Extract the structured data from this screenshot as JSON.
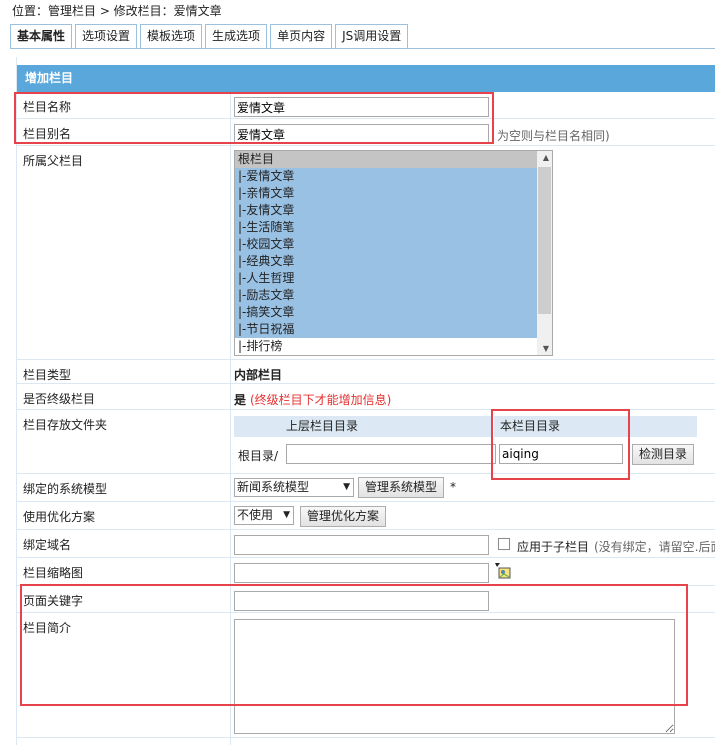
{
  "breadcrumb": "位置：管理栏目 > 修改栏目：爱情文章",
  "tabs": [
    "基本属性",
    "选项设置",
    "模板选项",
    "生成选项",
    "单页内容",
    "JS调用设置"
  ],
  "header": "增加栏目",
  "fields": {
    "name_label": "栏目名称",
    "name_value": "爱情文章",
    "alias_label": "栏目别名",
    "alias_value": "爱情文章",
    "alias_hint": "为空则与栏目名相同)",
    "parent_label": "所属父栏目",
    "parent_options": [
      "根栏目",
      "|-爱情文章",
      "|-亲情文章",
      "|-友情文章",
      "|-生活随笔",
      "|-校园文章",
      "|-经典文章",
      "|-人生哲理",
      "|-励志文章",
      "|-搞笑文章",
      "|-节日祝福",
      "|-排行榜"
    ],
    "type_label": "栏目类型",
    "type_value": "内部栏目",
    "final_label": "是否终级栏目",
    "final_value": "是",
    "final_note": "(终级栏目下才能增加信息)",
    "folder_label": "栏目存放文件夹",
    "folder_parent_head": "上层栏目目录",
    "folder_self_head": "本栏目目录",
    "folder_root": "根目录/",
    "folder_value": "aiqing",
    "check_dir_btn": "检测目录",
    "model_label": "绑定的系统模型",
    "model_value": "新闻系统模型",
    "manage_model_btn": "管理系统模型",
    "required_mark": "*",
    "opt_label": "使用优化方案",
    "opt_value": "不使用",
    "manage_opt_btn": "管理优化方案",
    "domain_label": "绑定域名",
    "domain_child_label": "应用于子栏目",
    "domain_hint": "(没有绑定，请留空.后面",
    "thumb_label": "栏目缩略图",
    "keyword_label": "页面关键字",
    "intro_label": "栏目简介"
  }
}
